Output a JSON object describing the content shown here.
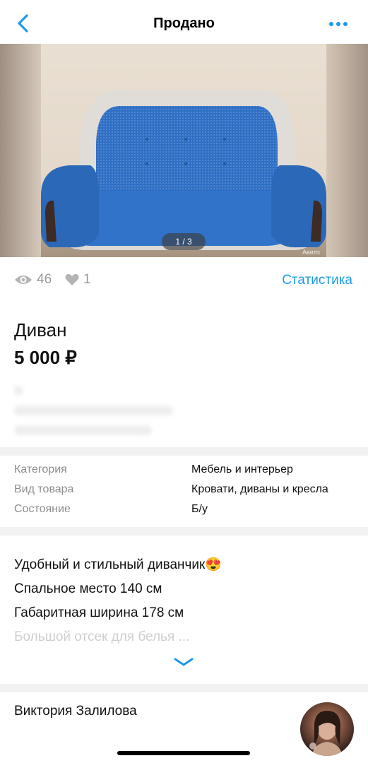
{
  "header": {
    "title": "Продано",
    "back_icon": "chevron-left-icon",
    "more_icon": "more-dots-icon",
    "accent_color": "#1a9be6"
  },
  "gallery": {
    "counter": "1 / 3",
    "watermark": "Авито"
  },
  "stats": {
    "views": "46",
    "likes": "1",
    "link_label": "Статистика"
  },
  "item": {
    "name": "Диван",
    "price": "5 000 ₽"
  },
  "params": [
    {
      "key": "Категория",
      "value": "Мебель и интерьер"
    },
    {
      "key": "Вид товара",
      "value": "Кровати, диваны и кресла"
    },
    {
      "key": "Состояние",
      "value": "Б/у"
    }
  ],
  "description": {
    "lines": [
      "Удобный и стильный диванчик😍",
      "Спальное место 140 см",
      "Габаритная ширина 178 см",
      "Большой отсек для белья ..."
    ]
  },
  "seller": {
    "name": "Виктория Залилова"
  }
}
